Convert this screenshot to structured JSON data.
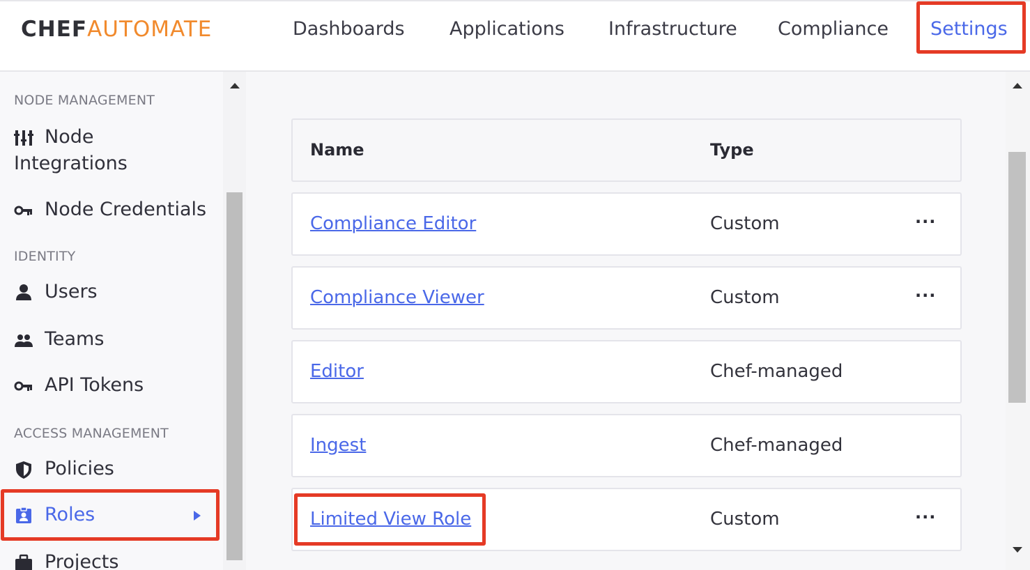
{
  "brand": {
    "part1": "CHEF",
    "part2": "AUTOMATE"
  },
  "nav": {
    "dashboards": "Dashboards",
    "applications": "Applications",
    "infrastructure": "Infrastructure",
    "compliance": "Compliance",
    "settings": "Settings"
  },
  "sidebar": {
    "node_management": {
      "heading": "NODE MANAGEMENT",
      "node_integrations_l1": "Node",
      "node_integrations_l2": "Integrations",
      "node_credentials": "Node Credentials"
    },
    "identity": {
      "heading": "IDENTITY",
      "users": "Users",
      "teams": "Teams",
      "api_tokens": "API Tokens"
    },
    "access_management": {
      "heading": "ACCESS MANAGEMENT",
      "policies": "Policies",
      "roles": "Roles",
      "projects": "Projects"
    }
  },
  "table": {
    "headers": {
      "name": "Name",
      "type": "Type"
    },
    "rows": [
      {
        "name": "Compliance Editor",
        "type": "Custom",
        "menu": "···"
      },
      {
        "name": "Compliance Viewer",
        "type": "Custom",
        "menu": "···"
      },
      {
        "name": "Editor",
        "type": "Chef-managed",
        "menu": ""
      },
      {
        "name": "Ingest",
        "type": "Chef-managed",
        "menu": ""
      },
      {
        "name": "Limited View Role",
        "type": "Custom",
        "menu": "···"
      }
    ]
  },
  "colors": {
    "accent": "#4a68e8",
    "brand_orange": "#f18a2d",
    "highlight": "#e53a25"
  }
}
